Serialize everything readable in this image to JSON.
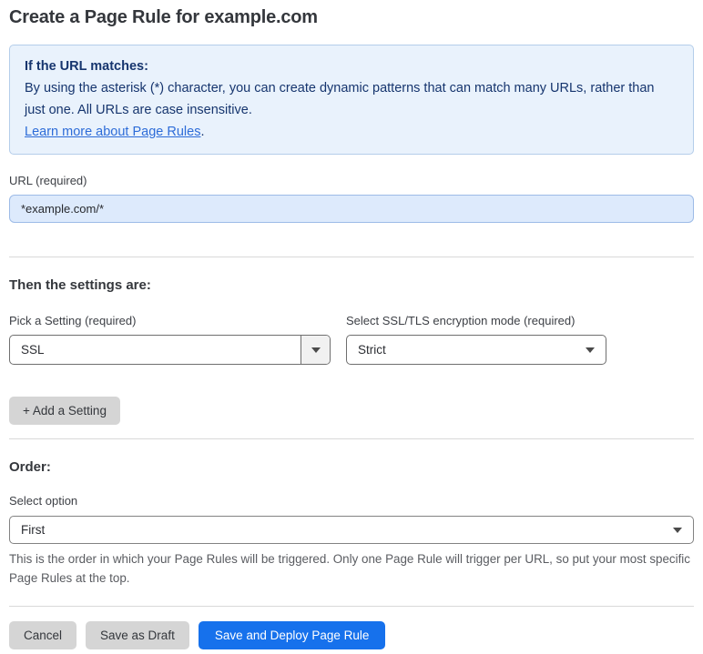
{
  "page": {
    "title": "Create a Page Rule for example.com"
  },
  "info_box": {
    "heading": "If the URL matches:",
    "body": "By using the asterisk (*) character, you can create dynamic patterns that can match many URLs, rather than just one. All URLs are case insensitive.",
    "link_label": "Learn more about Page Rules",
    "link_suffix": "."
  },
  "url_field": {
    "label": "URL (required)",
    "value": "*example.com/*"
  },
  "settings_section": {
    "heading": "Then the settings are:",
    "setting_picker": {
      "label": "Pick a Setting (required)",
      "selected": "SSL"
    },
    "ssl_mode_picker": {
      "label": "Select SSL/TLS encryption mode (required)",
      "selected": "Strict"
    },
    "add_setting_label": "+ Add a Setting"
  },
  "order_section": {
    "heading": "Order:",
    "select_label": "Select option",
    "selected": "First",
    "help_text": "This is the order in which your Page Rules will be triggered. Only one Page Rule will trigger per URL, so put your most specific Page Rules at the top."
  },
  "actions": {
    "cancel_label": "Cancel",
    "save_draft_label": "Save as Draft",
    "save_deploy_label": "Save and Deploy Page Rule"
  },
  "icons": {
    "dropdown_arrow": "caret-down"
  },
  "colors": {
    "info_bg": "#e9f2fc",
    "info_border": "#b4cdea",
    "info_text": "#16356e",
    "link_blue": "#2d6cd8",
    "url_input_bg": "#ddeafc",
    "url_input_border": "#9dbbe7",
    "primary_button_blue": "#1671ec",
    "secondary_button_gray": "#d5d5d5",
    "divider_gray": "#d9d9d9"
  }
}
